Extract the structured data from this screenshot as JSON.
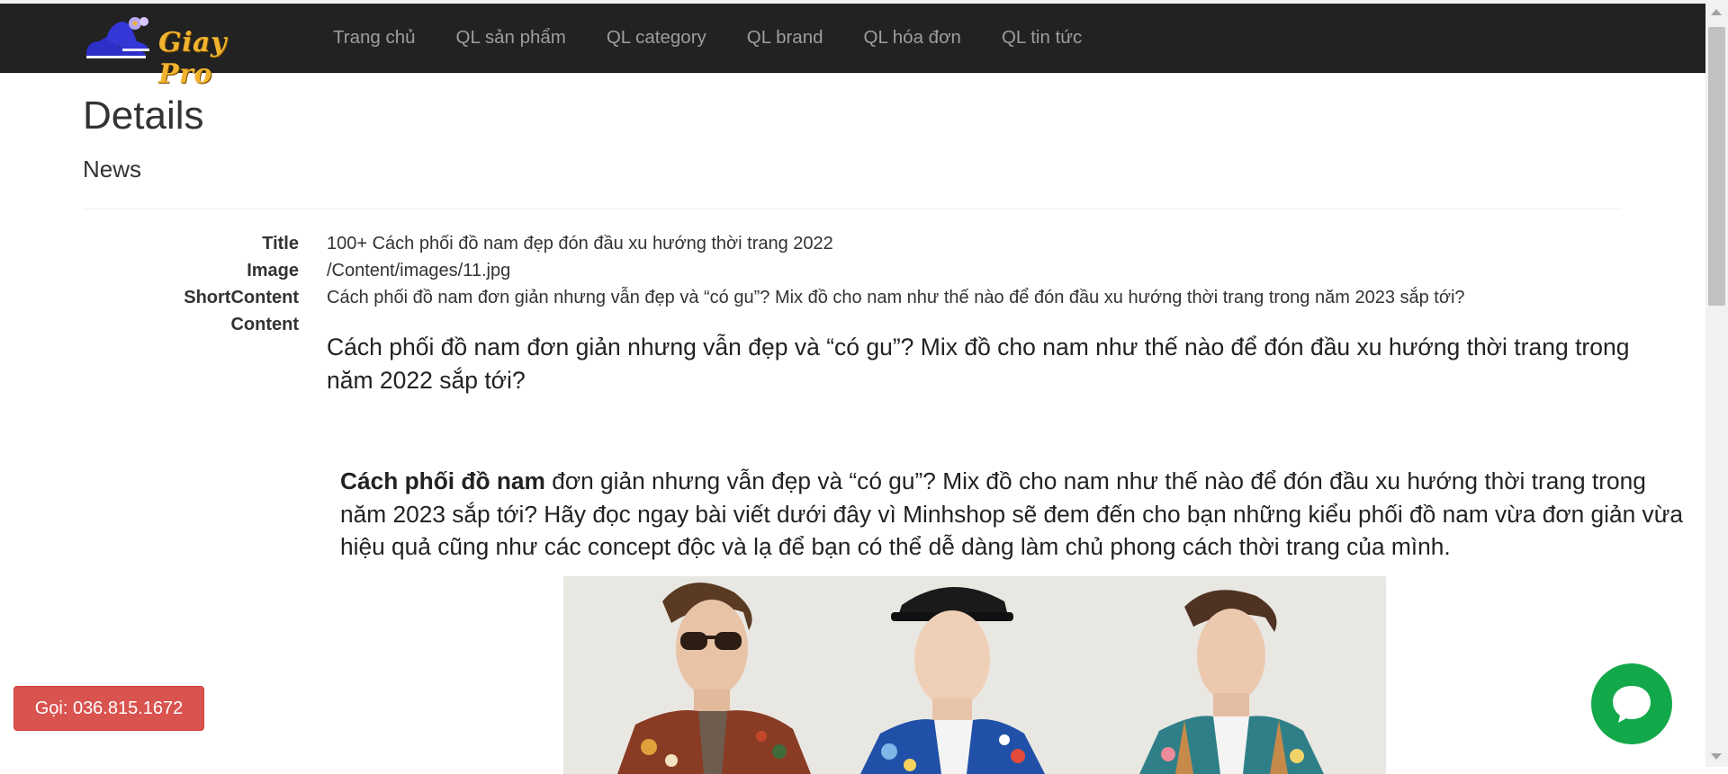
{
  "brand": {
    "name": "Giay Pro",
    "accent": "#f1b42f"
  },
  "nav": {
    "items": [
      {
        "label": "Trang chủ"
      },
      {
        "label": "QL sản phẩm"
      },
      {
        "label": "QL category"
      },
      {
        "label": "QL brand"
      },
      {
        "label": "QL hóa đơn"
      },
      {
        "label": "QL tin tức"
      }
    ]
  },
  "page": {
    "title": "Details",
    "subtitle": "News"
  },
  "details": {
    "title_label": "Title",
    "title_value": "100+ Cách phối đồ nam đẹp đón đầu xu hướng thời trang 2022",
    "image_label": "Image",
    "image_value": "/Content/images/11.jpg",
    "short_label": "ShortContent",
    "short_value": "Cách phối đồ nam đơn giản nhưng vẫn đẹp và “có gu”? Mix đồ cho nam như thế nào để đón đầu xu hướng thời trang trong năm 2023 sắp tới?",
    "content_label": "Content",
    "content_lead": "Cách phối đồ nam đơn giản nhưng vẫn đẹp và “có gu”? Mix đồ cho nam như thế nào để đón đầu xu hướng thời trang trong năm 2022 sắp tới?",
    "content_bold": "Cách phối đồ nam",
    "content_body": " đơn giản nhưng vẫn đẹp và “có gu”? Mix đồ cho nam như thế nào để đón đầu xu hướng thời trang trong năm 2023 sắp tới? Hãy đọc ngay bài viết dưới đây vì Minhshop sẽ đem đến cho bạn những kiểu phối đồ nam vừa đơn giản vừa hiệu quả cũng như các concept độc và lạ để bạn có thể dễ dàng làm chủ phong cách thời trang của mình."
  },
  "floating": {
    "call_label": "Gọi: 036.815.1672",
    "call_color": "#d9534f",
    "chat_color": "#13a94a",
    "chat_icon": "chat-bubble-icon"
  }
}
